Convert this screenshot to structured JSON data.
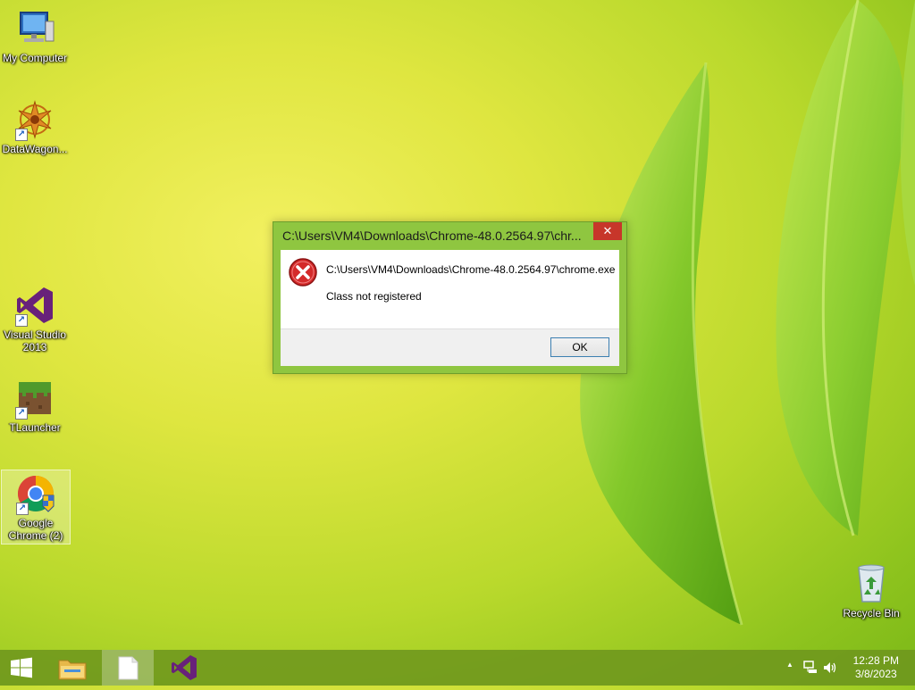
{
  "desktop": {
    "icons": [
      {
        "label": "My Computer"
      },
      {
        "label": "DataWagon..."
      },
      {
        "label": "Visual Studio 2013"
      },
      {
        "label": "TLauncher"
      },
      {
        "label": "Google Chrome (2)"
      },
      {
        "label": "Recycle Bin"
      }
    ]
  },
  "dialog": {
    "title": "C:\\Users\\VM4\\Downloads\\Chrome-48.0.2564.97\\chr...",
    "close_glyph": "✕",
    "path": "C:\\Users\\VM4\\Downloads\\Chrome-48.0.2564.97\\chrome.exe",
    "message": "Class not registered",
    "ok_label": "OK"
  },
  "taskbar": {
    "clock_time": "12:28 PM",
    "clock_date": "3/8/2023",
    "tray_chevron": "▲"
  }
}
